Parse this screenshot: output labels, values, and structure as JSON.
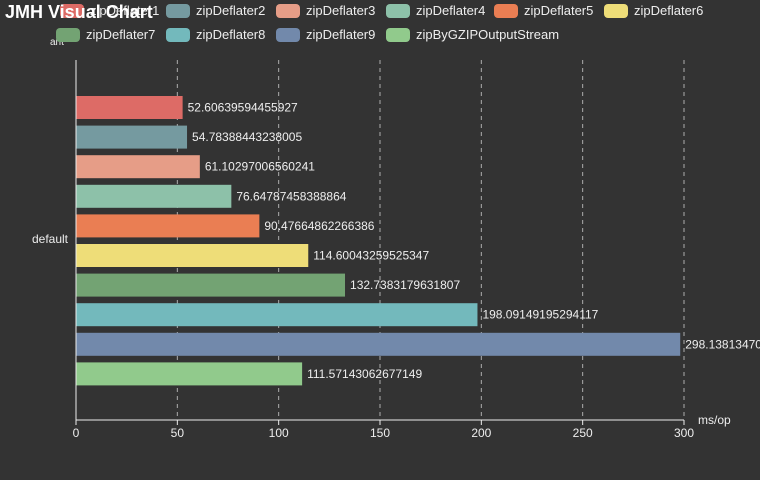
{
  "title": "JMH Visual Chart",
  "chart_data": {
    "type": "bar",
    "orientation": "horizontal",
    "categories": [
      "default"
    ],
    "ylabel_fragment": "ant",
    "xlabel": "ms/op",
    "xlim": [
      0,
      300
    ],
    "xticks": [
      0,
      50,
      100,
      150,
      200,
      250,
      300
    ],
    "grid": "vertical-dashed",
    "legend_position": "top",
    "series": [
      {
        "name": "zipDeflater1",
        "value": 52.60639594455927,
        "label": "52.60639594455927",
        "color": "#dd6b66"
      },
      {
        "name": "zipDeflater2",
        "value": 54.78388443238005,
        "label": "54.78388443238005",
        "color": "#759aa0"
      },
      {
        "name": "zipDeflater3",
        "value": 61.10297006560241,
        "label": "61.10297006560241",
        "color": "#e69d87"
      },
      {
        "name": "zipDeflater4",
        "value": 76.64787458388864,
        "label": "76.64787458388864",
        "color": "#8dc1a9"
      },
      {
        "name": "zipDeflater5",
        "value": 90.47664862266386,
        "label": "90.47664862266386",
        "color": "#ea7e53"
      },
      {
        "name": "zipDeflater6",
        "value": 114.60043259525347,
        "label": "114.60043259525347",
        "color": "#eedd78"
      },
      {
        "name": "zipDeflater7",
        "value": 132.7383179631807,
        "label": "132.7383179631807",
        "color": "#73a373"
      },
      {
        "name": "zipDeflater8",
        "value": 198.09149195294117,
        "label": "198.09149195294117",
        "color": "#73b9bc"
      },
      {
        "name": "zipDeflater9",
        "value": 298.1381347,
        "label": "298.13813470",
        "color": "#7289ab"
      },
      {
        "name": "zipByGZIPOutputStream",
        "value": 111.57143062677149,
        "label": "111.57143062677149",
        "color": "#91ca8c"
      }
    ]
  }
}
